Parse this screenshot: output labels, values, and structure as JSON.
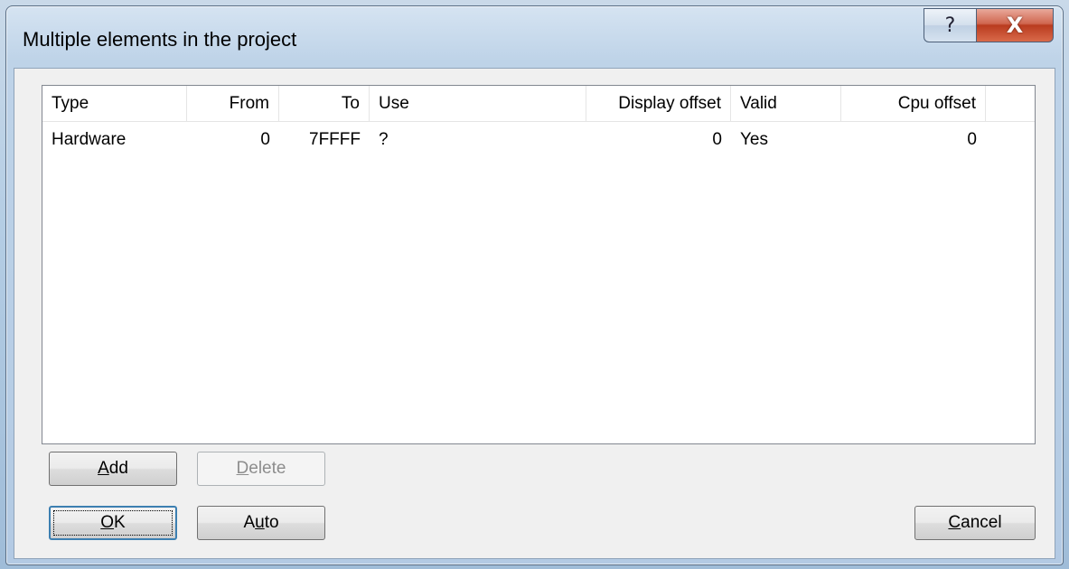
{
  "window": {
    "title": "Multiple elements in the project",
    "help_glyph": "?",
    "close_glyph": "X"
  },
  "list": {
    "columns": [
      "Type",
      "From",
      "To",
      "Use",
      "Display offset",
      "Valid",
      "Cpu offset"
    ],
    "rows": [
      {
        "type": "Hardware",
        "from": "0",
        "to": "7FFFF",
        "use": "?",
        "display_offset": "0",
        "valid": "Yes",
        "cpu_offset": "0"
      }
    ]
  },
  "buttons": {
    "add": {
      "accel": "A",
      "rest": "dd"
    },
    "delete": {
      "accel": "D",
      "rest": "elete"
    },
    "ok": {
      "accel": "O",
      "rest": "K"
    },
    "auto": {
      "pre": "A",
      "accel": "u",
      "rest": "to"
    },
    "cancel": {
      "accel": "C",
      "rest": "ancel"
    }
  },
  "icons": {
    "help": "help-icon",
    "close": "close-icon"
  }
}
